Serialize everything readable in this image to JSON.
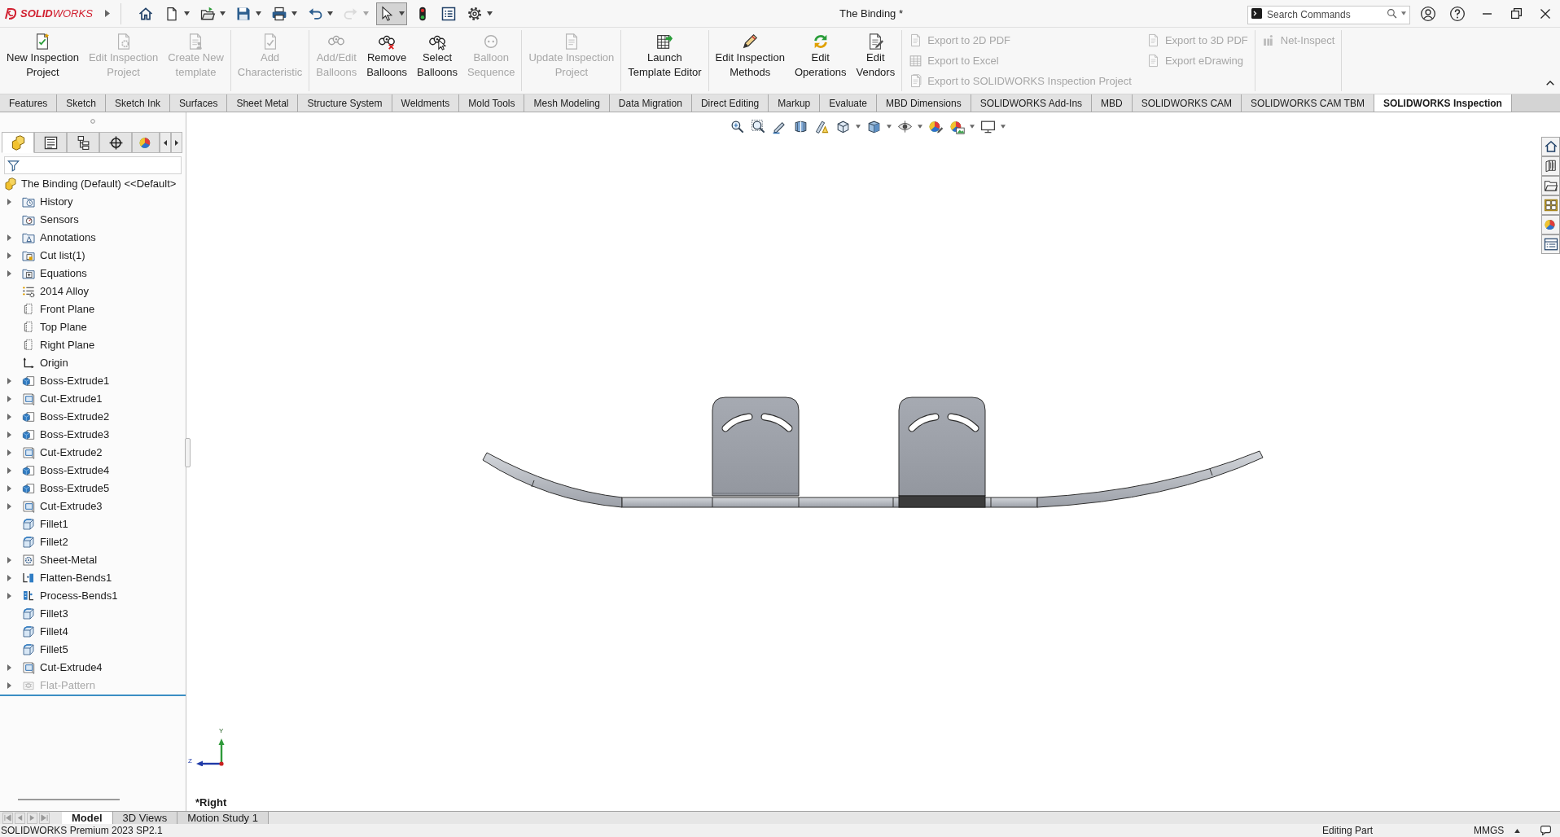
{
  "title_bar": {
    "logo": "**SOLID**WORKS",
    "title": "The Binding *",
    "search": {
      "placeholder": "Search Commands"
    }
  },
  "quick_access": [
    {
      "pressed": false,
      "disabled": false
    },
    {
      "pressed": false,
      "disabled": false
    },
    {
      "pressed": false,
      "disabled": false
    },
    {
      "pressed": false,
      "disabled": false
    },
    {
      "pressed": false,
      "disabled": false
    },
    {
      "pressed": false,
      "disabled": false
    },
    {
      "pressed": false,
      "disabled": true
    },
    {
      "pressed": true,
      "disabled": false
    },
    {
      "pressed": false,
      "disabled": false
    },
    {
      "pressed": false,
      "disabled": false
    },
    {
      "pressed": false,
      "disabled": false
    }
  ],
  "ribbon": {
    "groups": [
      {
        "buttons": [
          {
            "kind": "large",
            "label": "New Inspection\nProject",
            "disabled": false
          },
          {
            "kind": "large",
            "label": "Edit Inspection\nProject",
            "disabled": true
          },
          {
            "kind": "large",
            "label": "Create New\ntemplate",
            "disabled": true
          }
        ]
      },
      {
        "buttons": [
          {
            "kind": "large",
            "label": "Add\nCharacteristic",
            "disabled": true
          }
        ]
      },
      {
        "buttons": [
          {
            "kind": "large",
            "label": "Add/Edit\nBalloons",
            "disabled": true
          },
          {
            "kind": "large",
            "label": "Remove\nBalloons",
            "disabled": false
          },
          {
            "kind": "large",
            "label": "Select\nBalloons",
            "disabled": false
          },
          {
            "kind": "large",
            "label": "Balloon\nSequence",
            "disabled": true
          }
        ]
      },
      {
        "buttons": [
          {
            "kind": "large",
            "label": "Update Inspection\nProject",
            "disabled": true
          }
        ]
      },
      {
        "buttons": [
          {
            "kind": "large",
            "label": "Launch\nTemplate Editor",
            "disabled": false
          }
        ]
      },
      {
        "buttons": [
          {
            "kind": "large",
            "label": "Edit Inspection\nMethods",
            "disabled": false
          },
          {
            "kind": "large",
            "label": "Edit\nOperations",
            "disabled": false
          },
          {
            "kind": "large",
            "label": "Edit\nVendors",
            "disabled": false
          }
        ]
      },
      {
        "buttons": [
          {
            "kind": "small",
            "label": "Export to 2D PDF",
            "disabled": true
          },
          {
            "kind": "small",
            "label": "Export to Excel",
            "disabled": true
          },
          {
            "kind": "small",
            "label": "Export to SOLIDWORKS Inspection Project",
            "disabled": true
          },
          {
            "kind": "small",
            "label": "Export to 3D PDF",
            "disabled": true
          },
          {
            "kind": "small",
            "label": "Export eDrawing",
            "disabled": true
          }
        ]
      },
      {
        "buttons": [
          {
            "kind": "small",
            "label": "Net-Inspect",
            "disabled": true
          }
        ]
      }
    ]
  },
  "command_tabs": [
    {
      "label": "Features",
      "selected": false
    },
    {
      "label": "Sketch",
      "selected": false
    },
    {
      "label": "Sketch Ink",
      "selected": false
    },
    {
      "label": "Surfaces",
      "selected": false
    },
    {
      "label": "Sheet Metal",
      "selected": false
    },
    {
      "label": "Structure System",
      "selected": false
    },
    {
      "label": "Weldments",
      "selected": false
    },
    {
      "label": "Mold Tools",
      "selected": false
    },
    {
      "label": "Mesh Modeling",
      "selected": false
    },
    {
      "label": "Data Migration",
      "selected": false
    },
    {
      "label": "Direct Editing",
      "selected": false
    },
    {
      "label": "Markup",
      "selected": false
    },
    {
      "label": "Evaluate",
      "selected": false
    },
    {
      "label": "MBD Dimensions",
      "selected": false
    },
    {
      "label": "SOLIDWORKS Add-Ins",
      "selected": false
    },
    {
      "label": "MBD",
      "selected": false
    },
    {
      "label": "SOLIDWORKS CAM",
      "selected": false
    },
    {
      "label": "SOLIDWORKS CAM TBM",
      "selected": false
    },
    {
      "label": "SOLIDWORKS Inspection",
      "selected": true
    }
  ],
  "feature_manager": {
    "tabs": [
      {
        "selected": true
      },
      {
        "selected": false
      },
      {
        "selected": false
      },
      {
        "selected": false
      },
      {
        "selected": false
      }
    ],
    "tree": {
      "label": "The Binding (Default) <<Default>",
      "children": [
        {
          "label": "History",
          "kind": "history",
          "expandable": true,
          "suppressed": false
        },
        {
          "label": "Sensors",
          "kind": "sensors",
          "expandable": false,
          "suppressed": false
        },
        {
          "label": "Annotations",
          "kind": "annotations",
          "expandable": true,
          "suppressed": false
        },
        {
          "label": "Cut list(1)",
          "kind": "cut_list",
          "expandable": true,
          "suppressed": false
        },
        {
          "label": "Equations",
          "kind": "equations",
          "expandable": true,
          "suppressed": false
        },
        {
          "label": "2014 Alloy",
          "kind": "material",
          "expandable": false,
          "suppressed": false
        },
        {
          "label": "Front Plane",
          "kind": "plane",
          "expandable": false,
          "suppressed": false
        },
        {
          "label": "Top Plane",
          "kind": "plane",
          "expandable": false,
          "suppressed": false
        },
        {
          "label": "Right Plane",
          "kind": "plane",
          "expandable": false,
          "suppressed": false
        },
        {
          "label": "Origin",
          "kind": "origin",
          "expandable": false,
          "suppressed": false
        },
        {
          "label": "Boss-Extrude1",
          "kind": "boss_extrude",
          "expandable": true,
          "suppressed": false
        },
        {
          "label": "Cut-Extrude1",
          "kind": "cut_extrude",
          "expandable": true,
          "suppressed": false
        },
        {
          "label": "Boss-Extrude2",
          "kind": "boss_extrude",
          "expandable": true,
          "suppressed": false
        },
        {
          "label": "Boss-Extrude3",
          "kind": "boss_extrude",
          "expandable": true,
          "suppressed": false
        },
        {
          "label": "Cut-Extrude2",
          "kind": "cut_extrude",
          "expandable": true,
          "suppressed": false
        },
        {
          "label": "Boss-Extrude4",
          "kind": "boss_extrude",
          "expandable": true,
          "suppressed": false
        },
        {
          "label": "Boss-Extrude5",
          "kind": "boss_extrude",
          "expandable": true,
          "suppressed": false
        },
        {
          "label": "Cut-Extrude3",
          "kind": "cut_extrude",
          "expandable": true,
          "suppressed": false
        },
        {
          "label": "Fillet1",
          "kind": "fillet",
          "expandable": false,
          "suppressed": false
        },
        {
          "label": "Fillet2",
          "kind": "fillet",
          "expandable": false,
          "suppressed": false
        },
        {
          "label": "Sheet-Metal",
          "kind": "sheet_metal",
          "expandable": true,
          "suppressed": false
        },
        {
          "label": "Flatten-Bends1",
          "kind": "flatten_bends",
          "expandable": true,
          "suppressed": false
        },
        {
          "label": "Process-Bends1",
          "kind": "process_bends",
          "expandable": true,
          "suppressed": false
        },
        {
          "label": "Fillet3",
          "kind": "fillet",
          "expandable": false,
          "suppressed": false
        },
        {
          "label": "Fillet4",
          "kind": "fillet",
          "expandable": false,
          "suppressed": false
        },
        {
          "label": "Fillet5",
          "kind": "fillet",
          "expandable": false,
          "suppressed": false
        },
        {
          "label": "Cut-Extrude4",
          "kind": "cut_extrude",
          "expandable": true,
          "suppressed": false
        },
        {
          "label": "Flat-Pattern",
          "kind": "flat_pattern",
          "expandable": true,
          "suppressed": true
        }
      ]
    }
  },
  "viewport": {
    "triad": {
      "y_label": "Y",
      "z_label": "Z"
    },
    "view_name": "*Right"
  },
  "bottom_tabs": [
    {
      "label": "Model",
      "selected": true
    },
    {
      "label": "3D Views",
      "selected": false
    },
    {
      "label": "Motion Study 1",
      "selected": false
    }
  ],
  "status_bar": {
    "product": "SOLIDWORKS Premium 2023 SP2.1",
    "mode": "Editing Part",
    "units": "MMGS"
  }
}
